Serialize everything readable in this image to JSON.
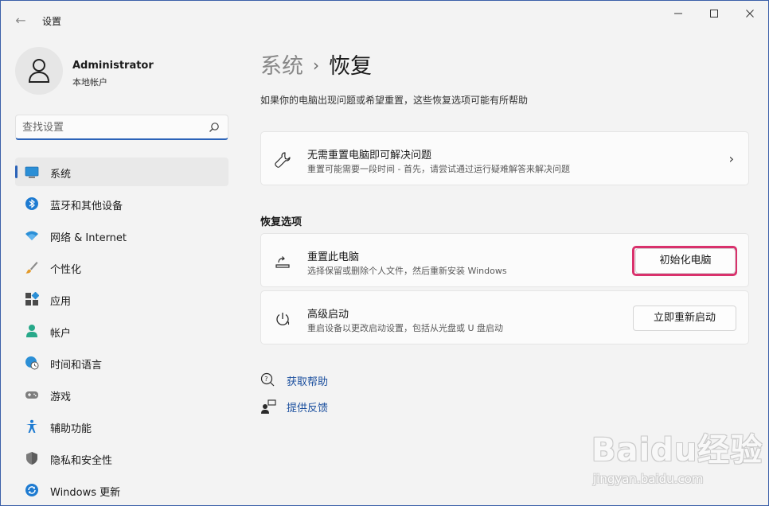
{
  "window": {
    "title": "设置",
    "back_glyph": "←",
    "minimize_glyph": "—",
    "maximize_glyph": "☐",
    "close_glyph": "✕"
  },
  "profile": {
    "name": "Administrator",
    "account_type": "本地帐户"
  },
  "search": {
    "placeholder": "查找设置",
    "icon": "search-icon"
  },
  "sidebar": {
    "accent_color": "#2b63b8",
    "items": [
      {
        "label": "系统",
        "icon": "monitor-icon",
        "active": true
      },
      {
        "label": "蓝牙和其他设备",
        "icon": "bluetooth-icon",
        "active": false
      },
      {
        "label": "网络 & Internet",
        "icon": "wifi-icon",
        "active": false
      },
      {
        "label": "个性化",
        "icon": "brush-icon",
        "active": false
      },
      {
        "label": "应用",
        "icon": "apps-icon",
        "active": false
      },
      {
        "label": "帐户",
        "icon": "person-icon",
        "active": false
      },
      {
        "label": "时间和语言",
        "icon": "globe-clock-icon",
        "active": false
      },
      {
        "label": "游戏",
        "icon": "gamepad-icon",
        "active": false
      },
      {
        "label": "辅助功能",
        "icon": "accessibility-icon",
        "active": false
      },
      {
        "label": "隐私和安全性",
        "icon": "shield-icon",
        "active": false
      },
      {
        "label": "Windows 更新",
        "icon": "update-icon",
        "active": false
      }
    ]
  },
  "main": {
    "breadcrumb": {
      "parent": "系统",
      "separator": "›",
      "current": "恢复"
    },
    "description": "如果你的电脑出现问题或希望重置，这些恢复选项可能有所帮助",
    "fix_card": {
      "title": "无需重置电脑即可解决问题",
      "subtitle": "重置可能需要一段时间 - 首先，请尝试通过运行疑难解答来解决问题",
      "chevron": "›"
    },
    "section_label": "恢复选项",
    "reset_card": {
      "title": "重置此电脑",
      "subtitle": "选择保留或删除个人文件，然后重新安装 Windows",
      "button_label": "初始化电脑",
      "highlight_color": "#d9316c"
    },
    "advanced_card": {
      "title": "高级启动",
      "subtitle": "重启设备以更改启动设置，包括从光盘或 U 盘启动",
      "button_label": "立即重新启动"
    },
    "links": {
      "help": "获取帮助",
      "feedback": "提供反馈"
    }
  },
  "watermark": {
    "main": "Baidu经验",
    "sub": "jingyan.baidu.com"
  }
}
